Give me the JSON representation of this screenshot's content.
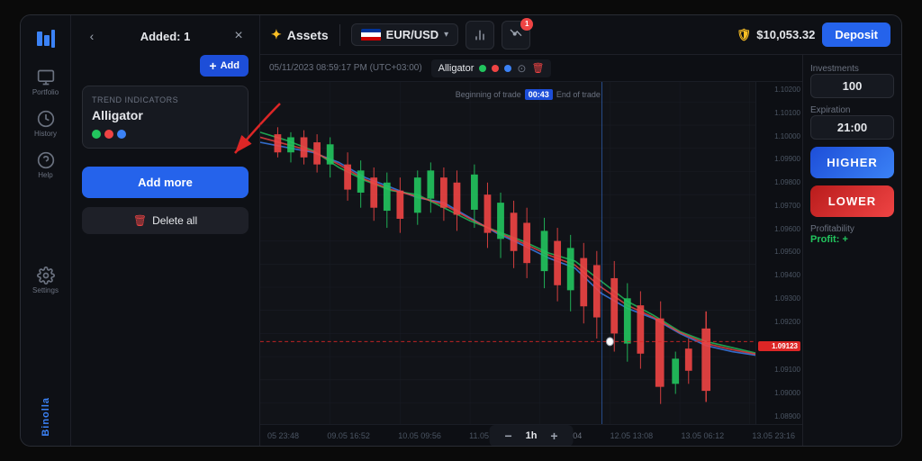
{
  "app": {
    "title": "Binolla",
    "logo_text": "Binolla"
  },
  "sidebar": {
    "items": [
      {
        "id": "portfolio",
        "label": "Portfolio",
        "icon": "📊"
      },
      {
        "id": "history",
        "label": "History",
        "icon": "🕐"
      },
      {
        "id": "help",
        "label": "Help",
        "icon": "❓"
      },
      {
        "id": "settings",
        "label": "Settings",
        "icon": "⚙"
      }
    ]
  },
  "left_panel": {
    "back_icon": "‹",
    "close_icon": "×",
    "added_label": "Added: 1",
    "add_button_label": "Add",
    "indicator_card": {
      "type_label": "Trend indicators",
      "name": "Alligator",
      "dots": [
        "green",
        "red",
        "blue"
      ]
    },
    "add_more_label": "Add more",
    "delete_all_label": "Delete all"
  },
  "top_bar": {
    "assets_label": "Assets",
    "asset_name": "EUR/USD",
    "chart_notifications": "1",
    "balance": "$10,053.32",
    "deposit_label": "Deposit"
  },
  "chart": {
    "datetime": "05/11/2023  08:59:17 PM (UTC+03:00)",
    "indicator_label": "Alligator",
    "trade_start_label": "Beginning of trade",
    "trade_time_badge": "00:43",
    "trade_end_label": "End of trade",
    "current_price": "1.09123",
    "price_levels": [
      "1.10200",
      "1.10100",
      "1.10000",
      "1.09900",
      "1.09800",
      "1.09700",
      "1.09600",
      "1.09500",
      "1.09400",
      "1.09300",
      "1.09200",
      "1.09123",
      "1.09100",
      "1.09000",
      "1.08900"
    ],
    "time_ticks": [
      "05 23:48",
      "09.05 16:52",
      "10.05 09:56",
      "11.05 03:00",
      "11.05 20:04",
      "12.05 13:08",
      "13.05 06:12",
      "13.05 23:16"
    ],
    "timeframe": "1h",
    "zoom_minus": "−",
    "zoom_plus": "+"
  },
  "right_panel": {
    "investments_label": "Investments",
    "investments_value": "100",
    "expiration_label": "Expiration",
    "expiration_value": "21:00",
    "higher_label": "HIGHER",
    "lower_label": "LOWER",
    "profitability_label": "Profitability",
    "profit_value": "Profit: +"
  }
}
